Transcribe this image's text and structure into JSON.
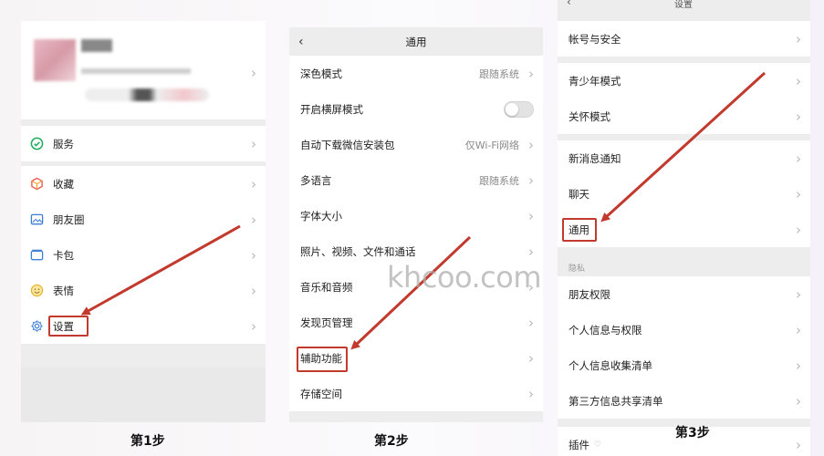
{
  "watermark": "khcoo.com",
  "steps": [
    "第1步",
    "第2步",
    "第3步"
  ],
  "panel1": {
    "items": [
      {
        "label": "服务",
        "icon": "wechat-pay-icon"
      },
      {
        "label": "收藏",
        "icon": "favorites-cube-icon"
      },
      {
        "label": "朋友圈",
        "icon": "moments-photo-icon"
      },
      {
        "label": "卡包",
        "icon": "card-wallet-icon"
      },
      {
        "label": "表情",
        "icon": "emoji-smile-icon"
      },
      {
        "label": "设置",
        "icon": "gear-icon"
      }
    ]
  },
  "panel2": {
    "title": "通用",
    "items": [
      {
        "label": "深色模式",
        "value": "跟随系统"
      },
      {
        "label": "开启横屏模式",
        "toggle": false
      },
      {
        "label": "自动下载微信安装包",
        "value": "仅Wi-Fi网络"
      },
      {
        "label": "多语言",
        "value": "跟随系统"
      },
      {
        "label": "字体大小"
      },
      {
        "label": "照片、视频、文件和通话"
      },
      {
        "label": "音乐和音频"
      },
      {
        "label": "发现页管理"
      },
      {
        "label": "辅助功能"
      },
      {
        "label": "存储空间"
      }
    ]
  },
  "panel3": {
    "title": "设置",
    "items": [
      "帐号与安全",
      "青少年模式",
      "关怀模式",
      "新消息通知",
      "聊天",
      "通用",
      "朋友权限",
      "个人信息与权限",
      "个人信息收集清单",
      "第三方信息共享清单",
      "插件"
    ],
    "section_privacy": "隐私"
  },
  "colors": {
    "highlight": "#c23a2e",
    "toggle_off": "#e3e3e3",
    "chevron": "#b7b7b7"
  }
}
